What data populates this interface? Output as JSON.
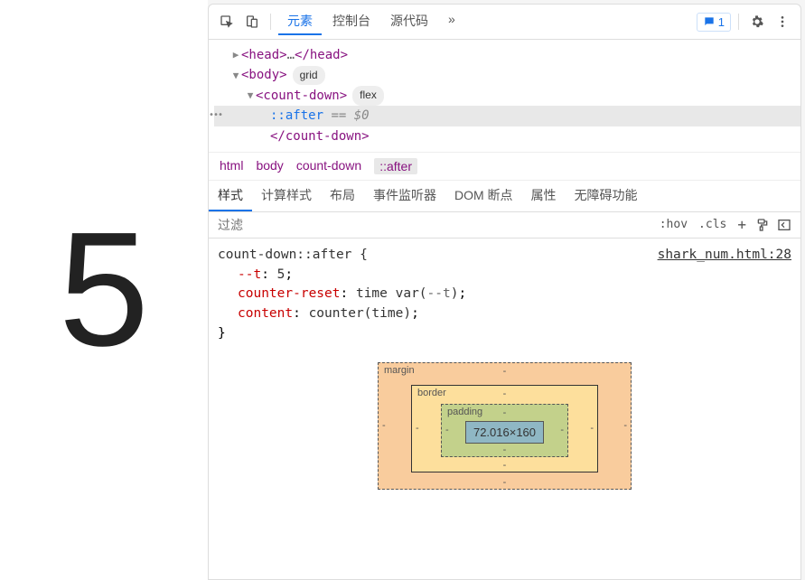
{
  "rendered_output": "5",
  "toolbar": {
    "tabs": [
      "元素",
      "控制台",
      "源代码"
    ],
    "overflow": "»",
    "issues_count": "1"
  },
  "dom": {
    "head_open": "<head>",
    "head_ellipsis": "…",
    "head_close": "</head>",
    "body_open": "<body>",
    "body_badge": "grid",
    "cd_open": "<count-down>",
    "cd_badge": "flex",
    "pseudo": "::after",
    "eq": "==",
    "winid": "$0",
    "cd_close": "</count-down>"
  },
  "breadcrumb": [
    "html",
    "body",
    "count-down",
    "::after"
  ],
  "sub_tabs": [
    "样式",
    "计算样式",
    "布局",
    "事件监听器",
    "DOM 断点",
    "属性",
    "无障碍功能"
  ],
  "filter": {
    "placeholder": "过滤",
    "hov": ":hov",
    "cls": ".cls",
    "plus": "+"
  },
  "rule": {
    "selector": "count-down::after {",
    "source": "shark_num.html:28",
    "p1_name": "--t",
    "p1_val": "5",
    "p2_name": "counter-reset",
    "p2_val_pre": "time var(",
    "p2_var": "--t",
    "p2_val_post": ")",
    "p3_name": "content",
    "p3_val": "counter(time)",
    "close": "}"
  },
  "box_model": {
    "margin_label": "margin",
    "border_label": "border",
    "padding_label": "padding",
    "content": "72.016×160",
    "dash": "-"
  }
}
